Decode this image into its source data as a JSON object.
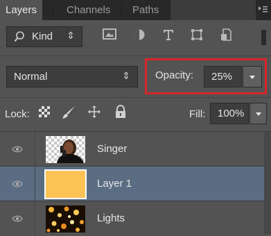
{
  "tabs": [
    {
      "label": "Layers",
      "active": true
    },
    {
      "label": "Channels",
      "active": false
    },
    {
      "label": "Paths",
      "active": false
    }
  ],
  "filter": {
    "kind_label": "Kind",
    "icons": [
      "image-filter-icon",
      "adjustment-filter-icon",
      "type-filter-icon",
      "shape-filter-icon",
      "smart-object-filter-icon"
    ]
  },
  "blend": {
    "mode": "Normal",
    "opacity_label": "Opacity:",
    "opacity_value": "25%"
  },
  "lock": {
    "label": "Lock:",
    "icons": [
      "lock-transparent-pixels-icon",
      "lock-image-pixels-icon",
      "lock-position-icon",
      "lock-all-icon"
    ],
    "fill_label": "Fill:",
    "fill_value": "100%"
  },
  "layers": [
    {
      "name": "Singer",
      "visible": true,
      "selected": false
    },
    {
      "name": "Layer 1",
      "visible": true,
      "selected": true,
      "fill_color": "#fbc256"
    },
    {
      "name": "Lights",
      "visible": true,
      "selected": false
    }
  ],
  "colors": {
    "panel_bg": "#535353",
    "selected_row": "#5a6d83",
    "highlight_box": "#d9252a"
  }
}
